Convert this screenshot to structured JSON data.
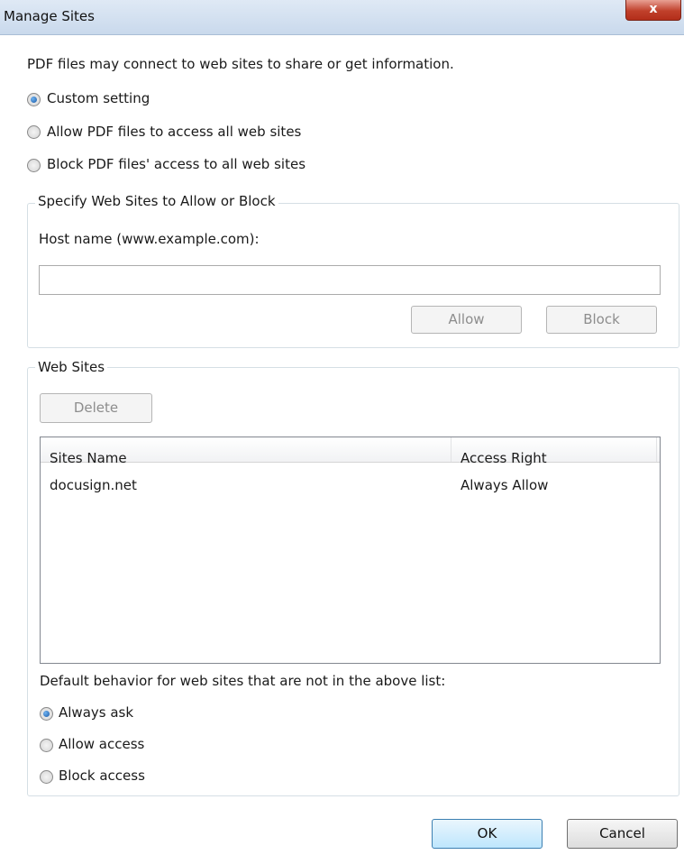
{
  "window": {
    "title": "Manage Sites",
    "close_label": "x"
  },
  "intro_text": "PDF files may connect to web sites to share or get information.",
  "access_mode": {
    "options": [
      {
        "label": "Custom setting",
        "checked": true
      },
      {
        "label": "Allow PDF files to access all web sites",
        "checked": false
      },
      {
        "label": "Block PDF files' access to all web sites",
        "checked": false
      }
    ]
  },
  "specify_group": {
    "legend": "Specify Web Sites to Allow or Block",
    "host_label": "Host name (www.example.com):",
    "host_value": "",
    "allow_label": "Allow",
    "block_label": "Block"
  },
  "websites_group": {
    "legend": "Web Sites",
    "delete_label": "Delete",
    "columns": [
      "Sites Name",
      "Access Right"
    ],
    "rows": [
      {
        "site": "docusign.net",
        "access": "Always Allow"
      }
    ],
    "default_behavior_label": "Default behavior for web sites that are not in the above list:",
    "default_options": [
      {
        "label": "Always ask",
        "checked": true
      },
      {
        "label": "Allow access",
        "checked": false
      },
      {
        "label": "Block access",
        "checked": false
      }
    ]
  },
  "footer": {
    "ok_label": "OK",
    "cancel_label": "Cancel"
  }
}
